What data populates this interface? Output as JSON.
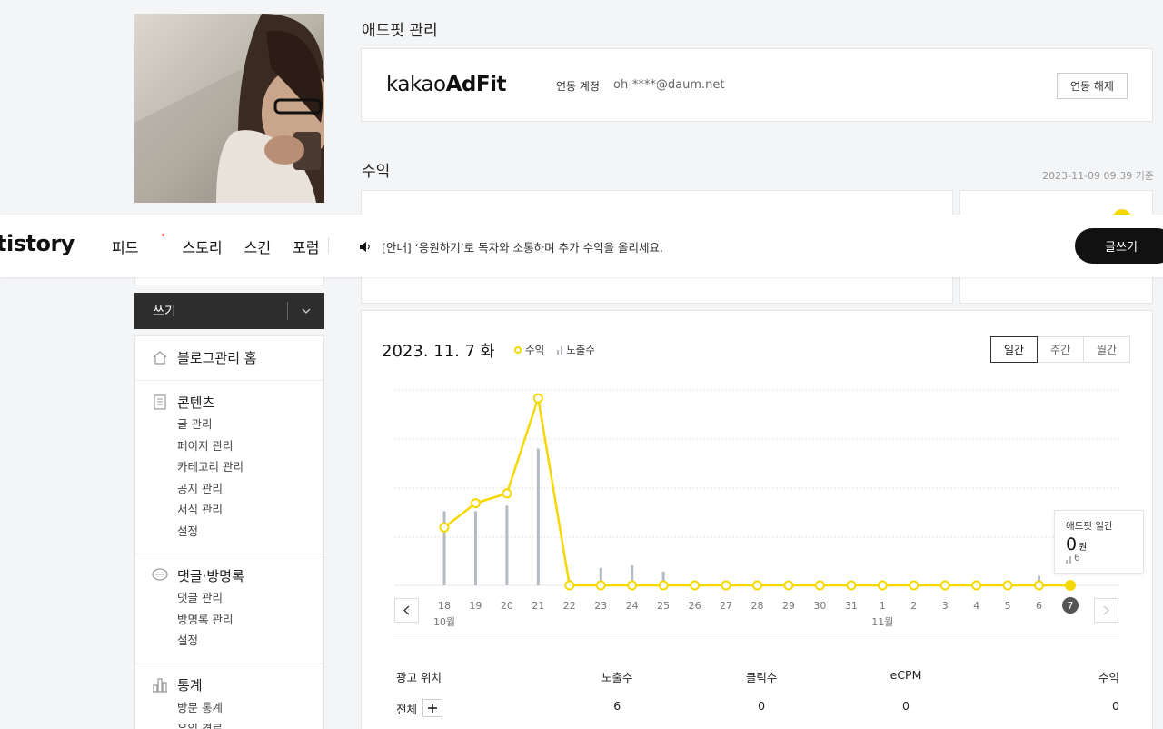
{
  "adfit": {
    "title": "애드핏 관리",
    "logo_light": "kakao",
    "logo_bold": "AdFit",
    "linked_label": "연동 계정",
    "linked_account": "oh-****@daum.net",
    "unlink_label": "연동 해제"
  },
  "revenue": {
    "title": "수익",
    "as_of": "2023-11-09 09:39 기준"
  },
  "topbar": {
    "logo": "tistory",
    "nav": [
      "피드",
      "스토리",
      "스킨",
      "포럼"
    ],
    "notice": "[안내] ‘응원하기’로 독자와 소통하며 추가 수익을 올리세요.",
    "write_label": "글쓰기"
  },
  "sidebar": {
    "write_label": "쓰기",
    "home_label": "블로그관리 홈",
    "sections": [
      {
        "title": "콘텐츠",
        "icon": "document-icon",
        "items": [
          "글 관리",
          "페이지 관리",
          "카테고리 관리",
          "공지 관리",
          "서식 관리",
          "설정"
        ]
      },
      {
        "title": "댓글·방명록",
        "icon": "speech-bubble-icon",
        "items": [
          "댓글 관리",
          "방명록 관리",
          "설정"
        ]
      },
      {
        "title": "통계",
        "icon": "bar-chart-icon",
        "items": [
          "방문 통계",
          "유입 경로"
        ]
      }
    ]
  },
  "chart_card": {
    "date": "2023. 11. 7",
    "weekday": "화",
    "legend_revenue": "수익",
    "legend_impressions": "노출수",
    "period_tabs": [
      "일간",
      "주간",
      "월간"
    ],
    "active_tab": "일간",
    "tooltip": {
      "title": "애드핏 일간",
      "value": "0",
      "unit": "원",
      "impressions": "6"
    }
  },
  "chart_data": {
    "type": "line",
    "x": [
      "18",
      "19",
      "20",
      "21",
      "22",
      "23",
      "24",
      "25",
      "26",
      "27",
      "28",
      "29",
      "30",
      "31",
      "1",
      "2",
      "3",
      "4",
      "5",
      "6",
      "7"
    ],
    "month_labels": [
      {
        "at": "18",
        "label": "10월"
      },
      {
        "at": "1",
        "label": "11월"
      }
    ],
    "selected": "7",
    "series": [
      {
        "name": "수익",
        "type": "line",
        "color": "#f5d800",
        "values": [
          160,
          227,
          254,
          517,
          0,
          0,
          0,
          0,
          0,
          0,
          0,
          0,
          0,
          0,
          0,
          0,
          0,
          0,
          0,
          0,
          0
        ]
      },
      {
        "name": "노출수",
        "type": "bar",
        "color": "#b4bac2",
        "values": [
          205,
          205,
          220,
          378,
          15,
          48,
          55,
          38,
          0,
          4,
          9,
          0,
          0,
          0,
          0,
          12,
          0,
          0,
          0,
          26,
          6
        ]
      }
    ],
    "grid": true
  },
  "summary_table": {
    "headers": [
      "광고 위치",
      "노출수",
      "클릭수",
      "eCPM",
      "수익"
    ],
    "row": {
      "label": "전체",
      "impressions": "6",
      "clicks": "0",
      "ecpm": "0",
      "revenue": "0"
    }
  },
  "colors": {
    "accent": "#f5d800",
    "bar": "#b4bac2",
    "dark": "#2d2d2d"
  }
}
